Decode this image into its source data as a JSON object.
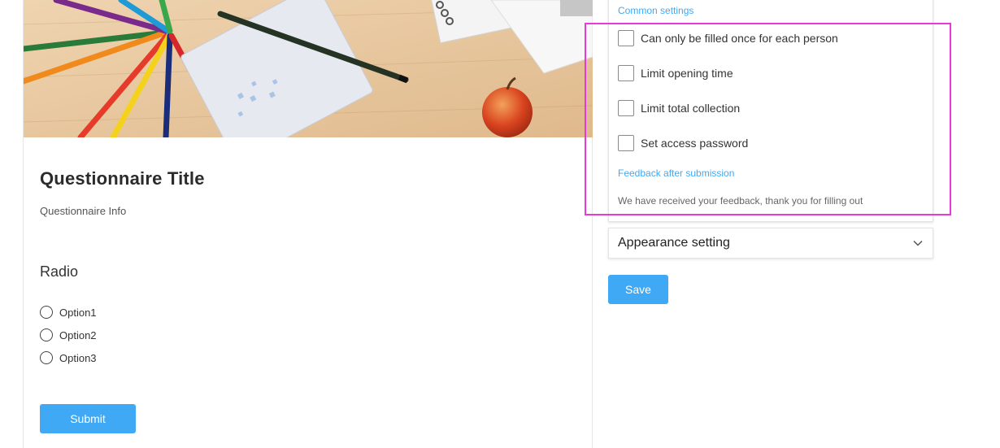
{
  "form": {
    "title": "Questionnaire Title",
    "info": "Questionnaire Info",
    "question": {
      "title": "Radio",
      "options": [
        "Option1",
        "Option2",
        "Option3"
      ]
    },
    "submit_label": "Submit"
  },
  "settings": {
    "common_label": "Common settings",
    "checkboxes": [
      {
        "label": "Can only be filled once for each person",
        "checked": false
      },
      {
        "label": "Limit opening time",
        "checked": false
      },
      {
        "label": "Limit total collection",
        "checked": false
      },
      {
        "label": "Set access password",
        "checked": false
      }
    ],
    "feedback_label": "Feedback after submission",
    "feedback_text": "We have received your feedback, thank you for filling out",
    "appearance_label": "Appearance setting",
    "save_label": "Save"
  },
  "colors": {
    "accent": "#3fa9f5",
    "highlight": "#e53ad9"
  }
}
